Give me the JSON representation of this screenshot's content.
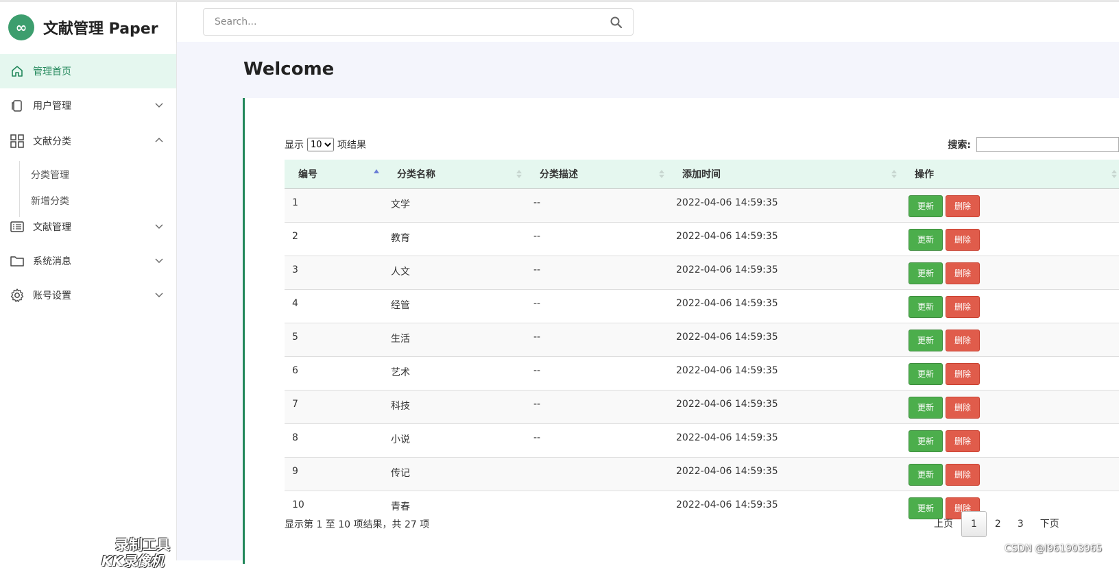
{
  "app": {
    "brand_icon": "∞",
    "brand_title": "文献管理 Paper",
    "accent_color": "#21875a",
    "logo_color": "#3d9e6e"
  },
  "sidebar": {
    "items": [
      {
        "label": "管理首页",
        "icon": "home-icon",
        "active": true
      },
      {
        "label": "用户管理",
        "icon": "copy-icon",
        "chevron": "down"
      },
      {
        "label": "文献分类",
        "icon": "grid-icon",
        "chevron": "up"
      },
      {
        "label": "文献管理",
        "icon": "list-icon",
        "chevron": "down"
      },
      {
        "label": "系统消息",
        "icon": "folder-icon",
        "chevron": "down"
      },
      {
        "label": "账号设置",
        "icon": "gear-icon",
        "chevron": "down"
      }
    ],
    "sub_items": [
      "分类管理",
      "新增分类"
    ]
  },
  "header": {
    "search_placeholder": "Search..."
  },
  "main": {
    "title": "Welcome",
    "length": {
      "prefix": "显示",
      "value": "10",
      "suffix": "项结果"
    },
    "filter_label": "搜索:",
    "columns": [
      "编号",
      "分类名称",
      "分类描述",
      "添加时间",
      "操作"
    ],
    "rows": [
      {
        "id": "1",
        "name": "文学",
        "desc": "--",
        "time": "2022-04-06 14:59:35"
      },
      {
        "id": "2",
        "name": "教育",
        "desc": "--",
        "time": "2022-04-06 14:59:35"
      },
      {
        "id": "3",
        "name": "人文",
        "desc": "--",
        "time": "2022-04-06 14:59:35"
      },
      {
        "id": "4",
        "name": "经管",
        "desc": "--",
        "time": "2022-04-06 14:59:35"
      },
      {
        "id": "5",
        "name": "生活",
        "desc": "--",
        "time": "2022-04-06 14:59:35"
      },
      {
        "id": "6",
        "name": "艺术",
        "desc": "--",
        "time": "2022-04-06 14:59:35"
      },
      {
        "id": "7",
        "name": "科技",
        "desc": "--",
        "time": "2022-04-06 14:59:35"
      },
      {
        "id": "8",
        "name": "小说",
        "desc": "--",
        "time": "2022-04-06 14:59:35"
      },
      {
        "id": "9",
        "name": "传记",
        "desc": "",
        "time": "2022-04-06 14:59:35"
      },
      {
        "id": "10",
        "name": "青春",
        "desc": "",
        "time": "2022-04-06 14:59:35"
      }
    ],
    "update_label": "更新",
    "delete_label": "删除",
    "info": "显示第 1 至 10 项结果，共 27 项",
    "pager": {
      "prev": "上页",
      "pages": [
        "1",
        "2",
        "3"
      ],
      "current": "1",
      "next": "下页"
    }
  },
  "overlays": {
    "recorder_line1": "录制工具",
    "recorder_line2": "KK录像机",
    "csdn": "CSDN @l961903965"
  }
}
